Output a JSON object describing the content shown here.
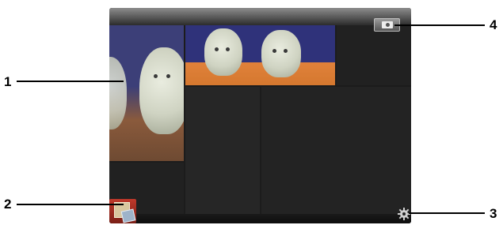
{
  "callouts": [
    {
      "number": "1",
      "target": "photo-thumbnail"
    },
    {
      "number": "2",
      "target": "photo-app-icon"
    },
    {
      "number": "3",
      "target": "settings-icon"
    },
    {
      "number": "4",
      "target": "camera-icon"
    }
  ],
  "icons": {
    "camera": "camera-icon",
    "settings": "gear-icon",
    "photo_app": "photo-gallery-icon"
  },
  "colors": {
    "screen_bg": "#1c1c1c",
    "callout": "#000000"
  }
}
